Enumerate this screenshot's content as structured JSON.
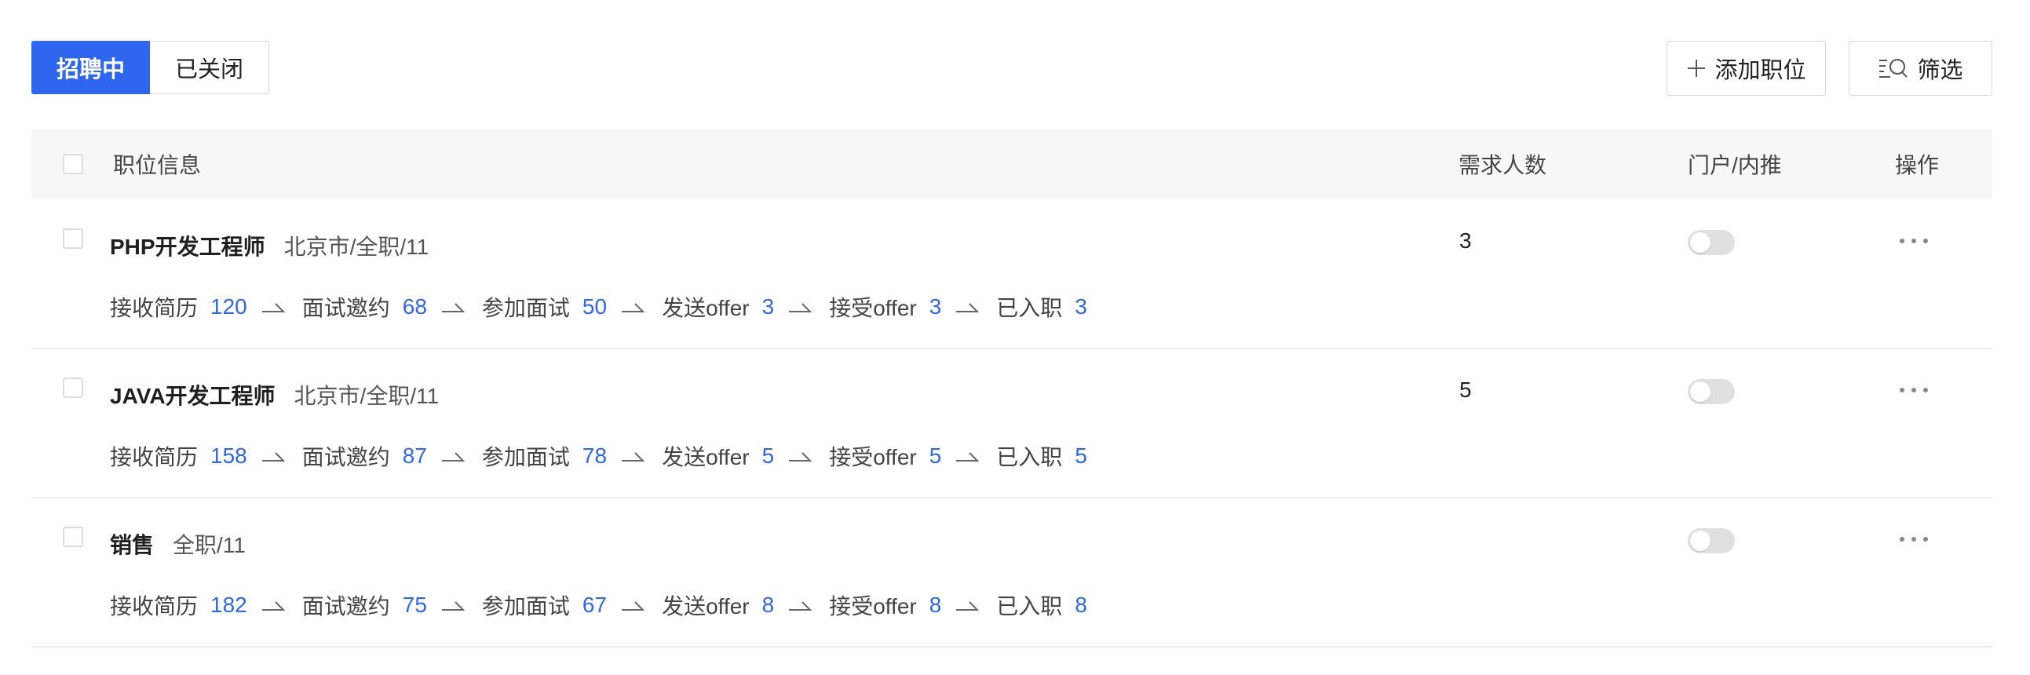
{
  "tabs": [
    {
      "label": "招聘中",
      "active": true
    },
    {
      "label": "已关闭",
      "active": false
    }
  ],
  "toolbar": {
    "add_label": "添加职位",
    "filter_label": "筛选"
  },
  "table": {
    "headers": {
      "info": "职位信息",
      "count": "需求人数",
      "portal": "门户/内推",
      "action": "操作"
    },
    "rows": [
      {
        "name": "PHP开发工程师",
        "meta": "北京市/全职/11",
        "count": "3",
        "portal_on": false,
        "stages": [
          {
            "label": "接收简历",
            "value": "120"
          },
          {
            "label": "面试邀约",
            "value": "68"
          },
          {
            "label": "参加面试",
            "value": "50"
          },
          {
            "label": "发送offer",
            "value": "3"
          },
          {
            "label": "接受offer",
            "value": "3"
          },
          {
            "label": "已入职",
            "value": "3"
          }
        ]
      },
      {
        "name": "JAVA开发工程师",
        "meta": "北京市/全职/11",
        "count": "5",
        "portal_on": false,
        "stages": [
          {
            "label": "接收简历",
            "value": "158"
          },
          {
            "label": "面试邀约",
            "value": "87"
          },
          {
            "label": "参加面试",
            "value": "78"
          },
          {
            "label": "发送offer",
            "value": "5"
          },
          {
            "label": "接受offer",
            "value": "5"
          },
          {
            "label": "已入职",
            "value": "5"
          }
        ]
      },
      {
        "name": "销售",
        "meta": "全职/11",
        "count": "",
        "portal_on": false,
        "stages": [
          {
            "label": "接收简历",
            "value": "182"
          },
          {
            "label": "面试邀约",
            "value": "75"
          },
          {
            "label": "参加面试",
            "value": "67"
          },
          {
            "label": "发送offer",
            "value": "8"
          },
          {
            "label": "接受offer",
            "value": "8"
          },
          {
            "label": "已入职",
            "value": "8"
          }
        ]
      }
    ]
  },
  "colors": {
    "accent": "#2f66f0",
    "header_bg": "#f7f7f7",
    "toggle_off": "#e0e0e0"
  },
  "icons": {
    "add": "plus-icon",
    "filter": "filter-search-icon",
    "arrow": "flow-arrow-icon",
    "more": "more-dots-icon"
  }
}
